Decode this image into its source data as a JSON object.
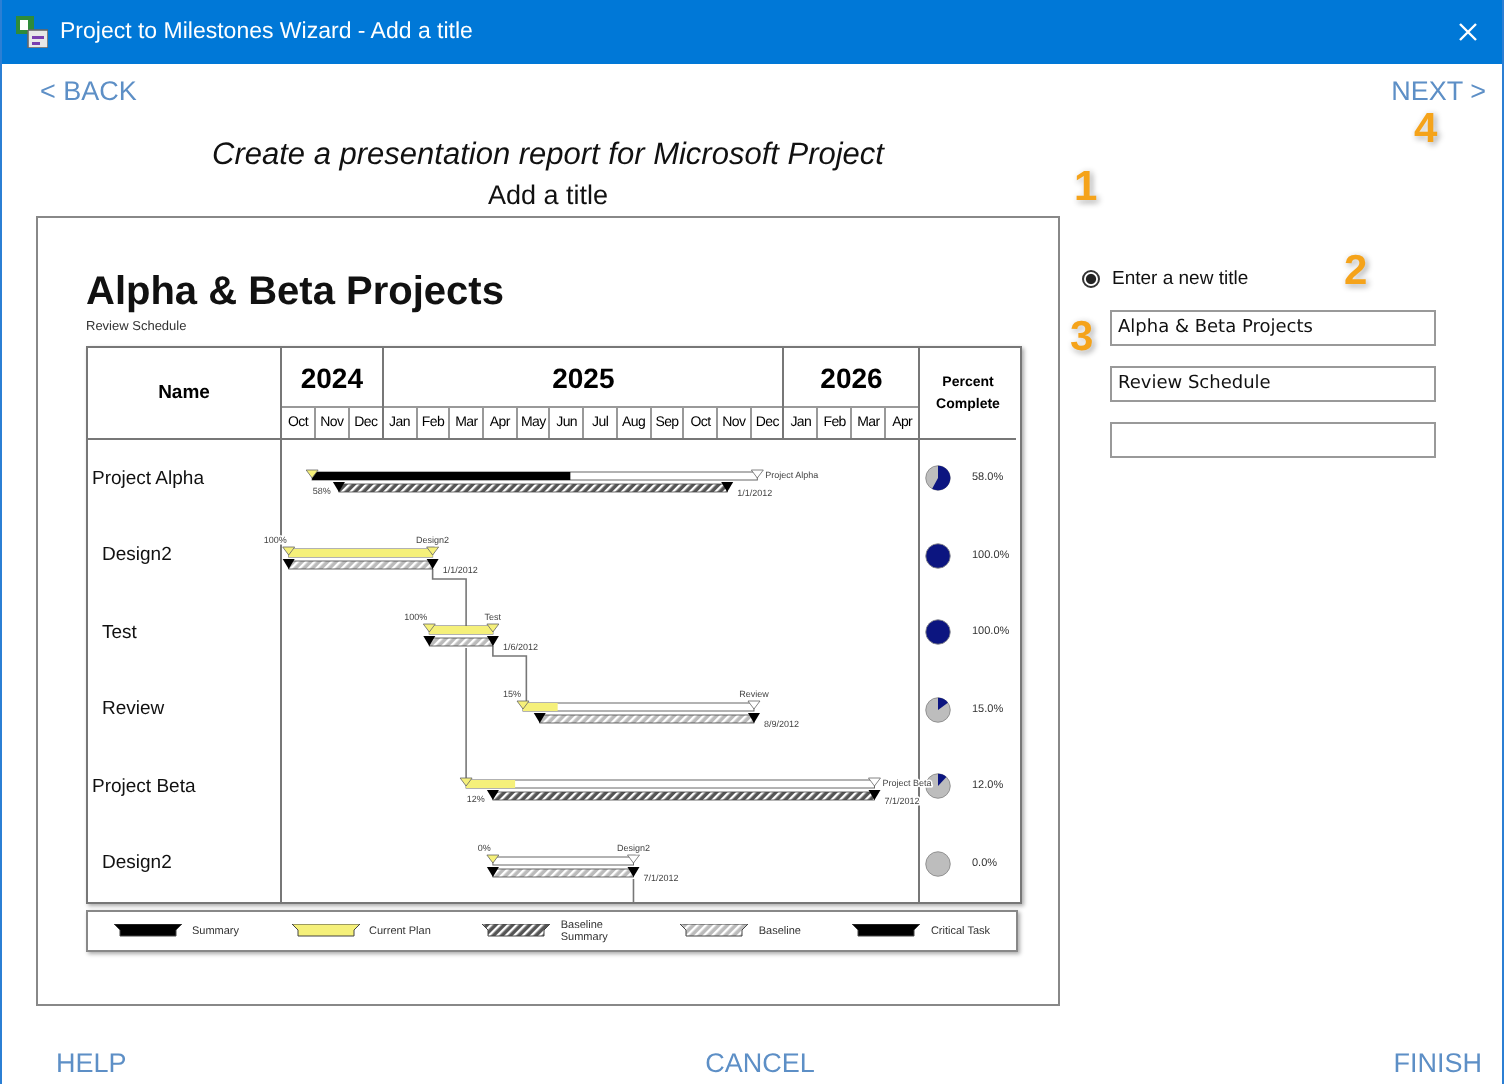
{
  "window": {
    "title": "Project to Milestones Wizard  - Add a title"
  },
  "nav": {
    "back": "< BACK",
    "next": "NEXT >"
  },
  "heading": "Create a presentation report for Microsoft Project",
  "subheading": "Add a title",
  "preview": {
    "title": "Alpha & Beta Projects",
    "subtitle": "Review Schedule",
    "name_header": "Name",
    "percent_header": "Percent Complete",
    "years": [
      {
        "label": "2024",
        "months": [
          "Oct",
          "Nov",
          "Dec"
        ]
      },
      {
        "label": "2025",
        "months": [
          "Jan",
          "Feb",
          "Mar",
          "Apr",
          "May",
          "Jun",
          "Jul",
          "Aug",
          "Sep",
          "Oct",
          "Nov",
          "Dec"
        ]
      },
      {
        "label": "2026",
        "months": [
          "Jan",
          "Feb",
          "Mar",
          "Apr"
        ]
      }
    ],
    "rows": [
      {
        "name": "Project  Alpha",
        "kind": "critical",
        "bar_percent": "58%",
        "bar_label": "Project Alpha",
        "bar_date": "1/1/2012",
        "complete": "58.0%",
        "level": 0.58
      },
      {
        "name": "Design2",
        "kind": "task",
        "bar_percent": "100%",
        "bar_label": "Design2",
        "bar_date": "1/1/2012",
        "complete": "100.0%",
        "level": 1
      },
      {
        "name": "Test",
        "kind": "task",
        "bar_percent": "100%",
        "bar_label": "Test",
        "bar_date": "1/6/2012",
        "complete": "100.0%",
        "level": 1
      },
      {
        "name": "Review",
        "kind": "task",
        "bar_percent": "15%",
        "bar_label": "Review",
        "bar_date": "8/9/2012",
        "complete": "15.0%",
        "level": 0.15
      },
      {
        "name": "Project Beta",
        "kind": "summary",
        "bar_percent": "12%",
        "bar_label": "Project Beta",
        "bar_date": "7/1/2012",
        "complete": "12.0%",
        "level": 0.12
      },
      {
        "name": "Design2",
        "kind": "task",
        "bar_percent": "0%",
        "bar_label": "Design2",
        "bar_date": "7/1/2012",
        "complete": "0.0%"
      }
    ],
    "legend": [
      {
        "kind": "summary",
        "label": "Summary"
      },
      {
        "kind": "current",
        "label": "Current Plan"
      },
      {
        "kind": "baseline_summary",
        "label": "Baseline Summary"
      },
      {
        "kind": "baseline",
        "label": "Baseline"
      },
      {
        "kind": "critical",
        "label": "Critical Task"
      }
    ]
  },
  "options": {
    "radio": {
      "label": "Enter a new title",
      "selected": true
    },
    "fields": [
      {
        "kind": "text",
        "value": "Alpha & Beta Projects"
      },
      {
        "kind": "text",
        "value": "Review Schedule"
      },
      {
        "kind": "empty"
      }
    ]
  },
  "steps": [
    "1",
    "2",
    "3",
    "4"
  ],
  "footer": {
    "help": "HELP",
    "cancel": "CANCEL",
    "finish": "FINISH"
  }
}
